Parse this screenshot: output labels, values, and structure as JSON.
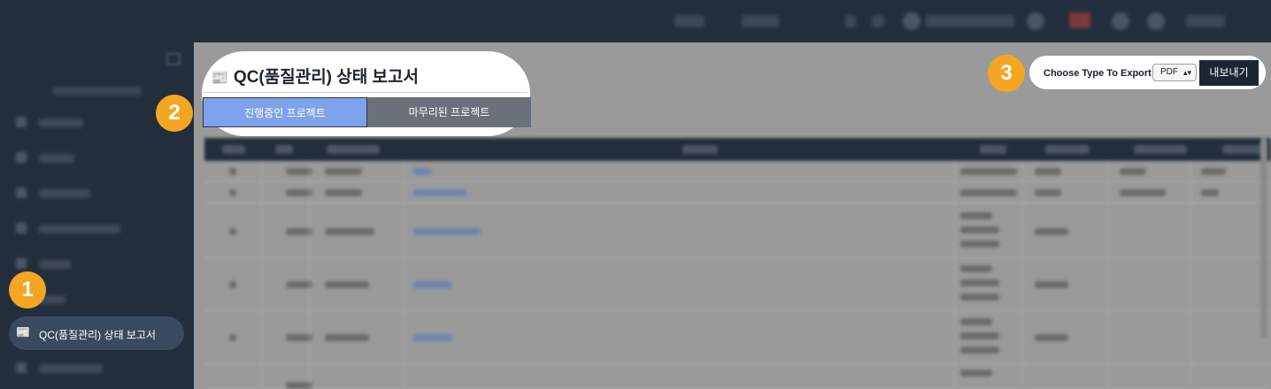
{
  "sidebar": {
    "active_item": {
      "icon": "newspaper-icon",
      "label": "QC(품질관리) 상태 보고서"
    }
  },
  "page": {
    "title_icon": "newspaper-icon",
    "title": "QC(품질관리) 상태 보고서",
    "tabs": [
      {
        "label": "진행중인 프로젝트",
        "active": true
      },
      {
        "label": "마무리된 프로젝트",
        "active": false
      }
    ]
  },
  "export": {
    "label": "Choose Type To Export :",
    "selected": "PDF",
    "button": "내보내기"
  },
  "badges": [
    "1",
    "2",
    "3"
  ],
  "colors": {
    "badge": "#f4a623",
    "active_tab": "#7fa3ea",
    "sidebar": "#232e3c"
  }
}
